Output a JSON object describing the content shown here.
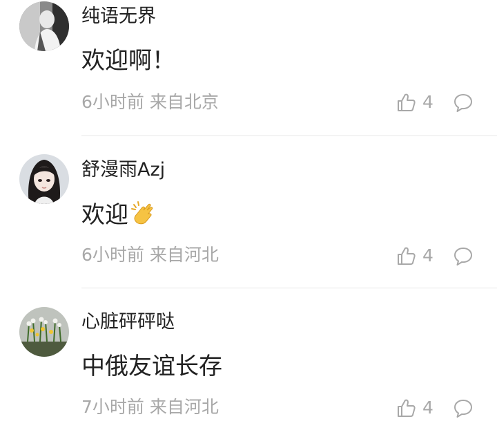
{
  "comments": [
    {
      "username": "纯语无界",
      "content": "欢迎啊！",
      "time": "6小时前",
      "location": "来自北京",
      "likes": "4",
      "avatar": "black-and-white-figure-photo"
    },
    {
      "username": "舒漫雨Azj",
      "content": "欢迎",
      "emoji": "clapping-hands",
      "time": "6小时前",
      "location": "来自河北",
      "likes": "4",
      "avatar": "illustrated-girl-portrait"
    },
    {
      "username": "心脏砰砰哒",
      "content": "中俄友谊长存",
      "time": "7小时前",
      "location": "来自河北",
      "likes": "4",
      "avatar": "potted-daffodils-photo"
    }
  ],
  "colors": {
    "text": "#222222",
    "meta": "#a8a8a8",
    "divider": "#e6e6e6"
  }
}
